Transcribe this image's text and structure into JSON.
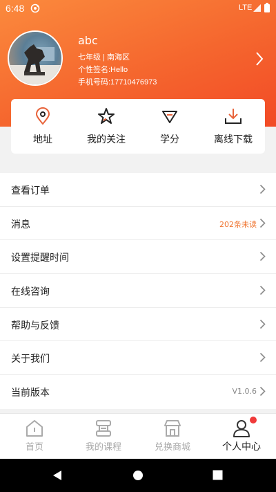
{
  "status_bar": {
    "time": "6:48",
    "network": "LTE"
  },
  "profile": {
    "name": "abc",
    "grade_region": "七年级 | 南海区",
    "signature": "个性签名:Hello",
    "phone": "手机号码:17710476973"
  },
  "quick_actions": [
    {
      "label": "地址",
      "icon": "location-pin-icon"
    },
    {
      "label": "我的关注",
      "icon": "star-icon"
    },
    {
      "label": "学分",
      "icon": "diamond-icon"
    },
    {
      "label": "离线下载",
      "icon": "download-icon"
    }
  ],
  "menu": [
    {
      "label": "查看订单",
      "extra": ""
    },
    {
      "label": "消息",
      "extra": "202条未读"
    },
    {
      "label": "设置提醒时间",
      "extra": ""
    },
    {
      "label": "在线咨询",
      "extra": ""
    },
    {
      "label": "帮助与反馈",
      "extra": ""
    },
    {
      "label": "关于我们",
      "extra": ""
    },
    {
      "label": "当前版本",
      "extra": "V1.0.6"
    }
  ],
  "tabs": [
    {
      "label": "首页",
      "icon": "home-icon",
      "active": false
    },
    {
      "label": "我的课程",
      "icon": "courses-icon",
      "active": false
    },
    {
      "label": "兑换商城",
      "icon": "store-icon",
      "active": false
    },
    {
      "label": "个人中心",
      "icon": "person-icon",
      "active": true
    }
  ],
  "colors": {
    "accent": "#f5662e",
    "unread_text": "#f0742f",
    "version_text": "#888888",
    "tab_inactive": "#aaaaaa",
    "tab_active": "#222222",
    "badge": "#f03a3a"
  }
}
